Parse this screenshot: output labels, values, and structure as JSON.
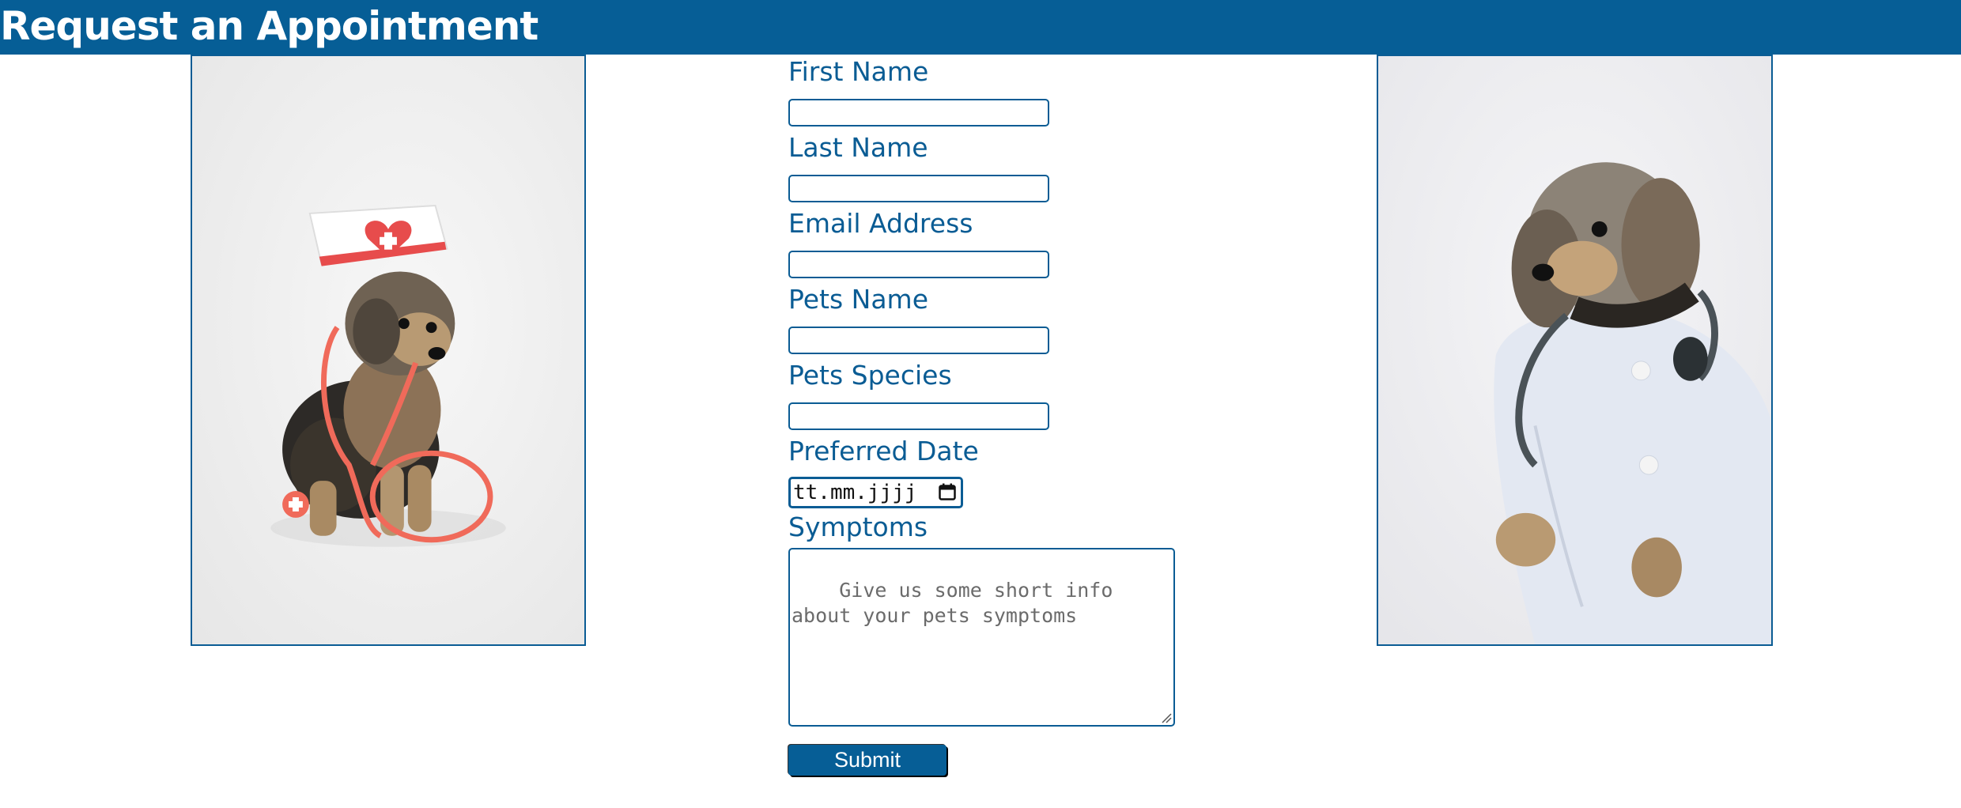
{
  "header": {
    "title": "Request an Appointment",
    "background": "#065e96"
  },
  "accent_color": "#0a5c94",
  "images": {
    "left": {
      "description_icon": "dog-nurse-photo"
    },
    "right": {
      "description_icon": "dog-doctor-photo"
    }
  },
  "form": {
    "first_name_label": "First Name",
    "first_name_value": "",
    "last_name_label": "Last Name",
    "last_name_value": "",
    "email_label": "Email Address",
    "email_value": "",
    "pet_name_label": "Pets Name",
    "pet_name_value": "",
    "pet_species_label": "Pets Species",
    "pet_species_value": "",
    "date_label": "Preferred Date",
    "date_placeholder": "tt.mm.jjjj",
    "symptoms_label": "Symptoms",
    "symptoms_placeholder": "Give us some short info about your pets symptoms",
    "submit_label": "Submit"
  }
}
